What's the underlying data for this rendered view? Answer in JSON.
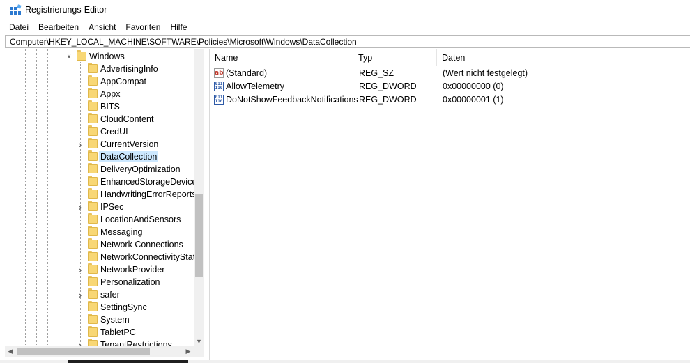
{
  "window": {
    "title": "Registrierungs-Editor"
  },
  "menu": [
    "Datei",
    "Bearbeiten",
    "Ansicht",
    "Favoriten",
    "Hilfe"
  ],
  "address": "Computer\\HKEY_LOCAL_MACHINE\\SOFTWARE\\Policies\\Microsoft\\Windows\\DataCollection",
  "tree": {
    "parent": {
      "label": "Windows",
      "expanded": true
    },
    "items": [
      {
        "label": "AdvertisingInfo",
        "expandable": false,
        "selected": false
      },
      {
        "label": "AppCompat",
        "expandable": false,
        "selected": false
      },
      {
        "label": "Appx",
        "expandable": false,
        "selected": false
      },
      {
        "label": "BITS",
        "expandable": false,
        "selected": false
      },
      {
        "label": "CloudContent",
        "expandable": false,
        "selected": false
      },
      {
        "label": "CredUI",
        "expandable": false,
        "selected": false
      },
      {
        "label": "CurrentVersion",
        "expandable": true,
        "selected": false
      },
      {
        "label": "DataCollection",
        "expandable": false,
        "selected": true
      },
      {
        "label": "DeliveryOptimization",
        "expandable": false,
        "selected": false
      },
      {
        "label": "EnhancedStorageDevices",
        "expandable": false,
        "selected": false
      },
      {
        "label": "HandwritingErrorReports",
        "expandable": false,
        "selected": false
      },
      {
        "label": "IPSec",
        "expandable": true,
        "selected": false
      },
      {
        "label": "LocationAndSensors",
        "expandable": false,
        "selected": false
      },
      {
        "label": "Messaging",
        "expandable": false,
        "selected": false
      },
      {
        "label": "Network Connections",
        "expandable": false,
        "selected": false
      },
      {
        "label": "NetworkConnectivityStat",
        "expandable": false,
        "selected": false
      },
      {
        "label": "NetworkProvider",
        "expandable": true,
        "selected": false
      },
      {
        "label": "Personalization",
        "expandable": false,
        "selected": false
      },
      {
        "label": "safer",
        "expandable": true,
        "selected": false
      },
      {
        "label": "SettingSync",
        "expandable": false,
        "selected": false
      },
      {
        "label": "System",
        "expandable": false,
        "selected": false
      },
      {
        "label": "TabletPC",
        "expandable": false,
        "selected": false
      },
      {
        "label": "TenantRestrictions",
        "expandable": true,
        "selected": false
      }
    ]
  },
  "list": {
    "columns": {
      "name": "Name",
      "type": "Typ",
      "data": "Daten"
    },
    "rows": [
      {
        "icon": "string-value-icon",
        "name": "(Standard)",
        "type": "REG_SZ",
        "data": "(Wert nicht festgelegt)"
      },
      {
        "icon": "dword-value-icon",
        "name": "AllowTelemetry",
        "type": "REG_DWORD",
        "data": "0x00000000 (0)"
      },
      {
        "icon": "dword-value-icon",
        "name": "DoNotShowFeedbackNotifications",
        "type": "REG_DWORD",
        "data": "0x00000001 (1)"
      }
    ]
  },
  "colors": {
    "selection": "#cce8ff",
    "folder": "#f8d775",
    "scrollbar_thumb": "#c1c1c1"
  }
}
